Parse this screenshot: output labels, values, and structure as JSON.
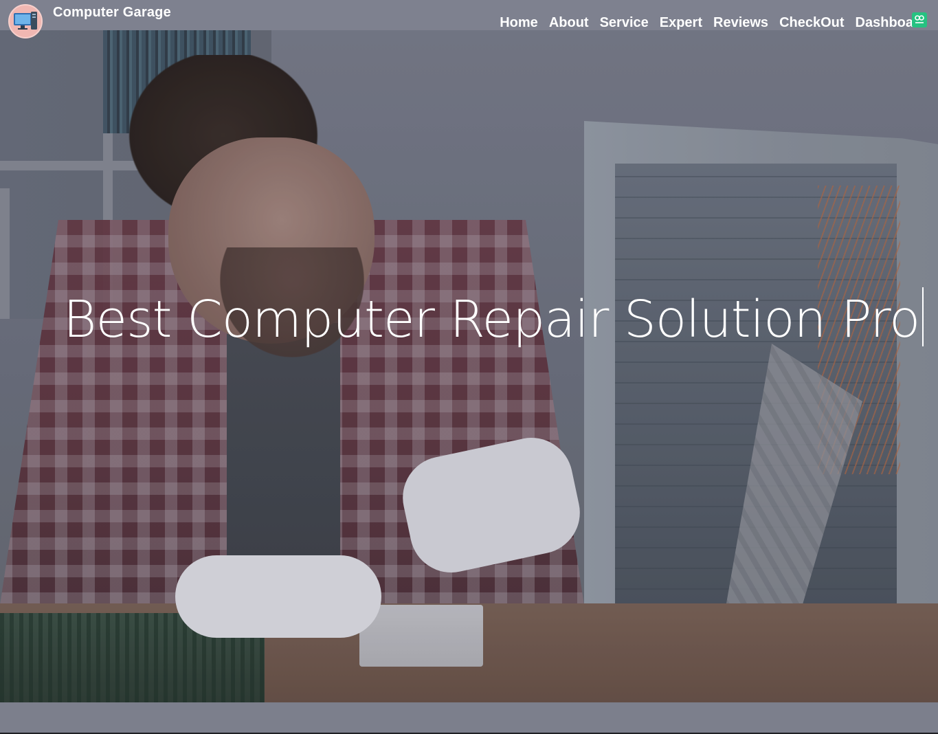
{
  "header": {
    "brand": "Computer Garage",
    "nav_items": [
      {
        "label": "Home"
      },
      {
        "label": "About"
      },
      {
        "label": "Service"
      },
      {
        "label": "Expert"
      },
      {
        "label": "Reviews"
      },
      {
        "label": "CheckOut"
      },
      {
        "label": "Dashboard"
      }
    ],
    "logo_icon": "computer-icon",
    "extension_icon": "extension-badge-icon"
  },
  "hero": {
    "headline": "Best Computer Repair Solution Pro",
    "tint_color": "#7e818f"
  },
  "colors": {
    "navbar": "#7e818f",
    "text": "#ffffff",
    "logo_bg": "#f0b7b2",
    "badge": "#26c281"
  }
}
